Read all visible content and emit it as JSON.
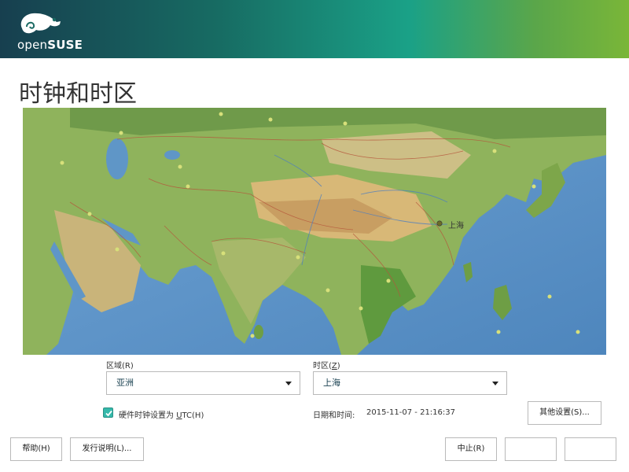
{
  "header": {
    "logo_text_prefix": "open",
    "logo_text_bold": "SUSE",
    "page_title": "时钟和时区"
  },
  "map": {
    "city_label": "上海"
  },
  "region": {
    "label": "区域(R)",
    "value": "亚洲"
  },
  "timezone": {
    "label_prefix": "时区(",
    "label_key": "Z",
    "label_suffix": ")",
    "value": "上海"
  },
  "utc": {
    "checked": true,
    "label_prefix": "硬件时钟设置为 ",
    "label_key": "U",
    "label_suffix": "TC(H)"
  },
  "datetime": {
    "label": "日期和时间:",
    "value": "2015-11-07 - 21:16:37"
  },
  "buttons": {
    "other_settings": "其他设置(S)...",
    "help": "帮助(H)",
    "release_notes": "发行说明(L)...",
    "abort": "中止(R)"
  },
  "colors": {
    "banner_start": "#173f4f",
    "banner_end": "#7ab638",
    "accent": "#35b9ab"
  }
}
